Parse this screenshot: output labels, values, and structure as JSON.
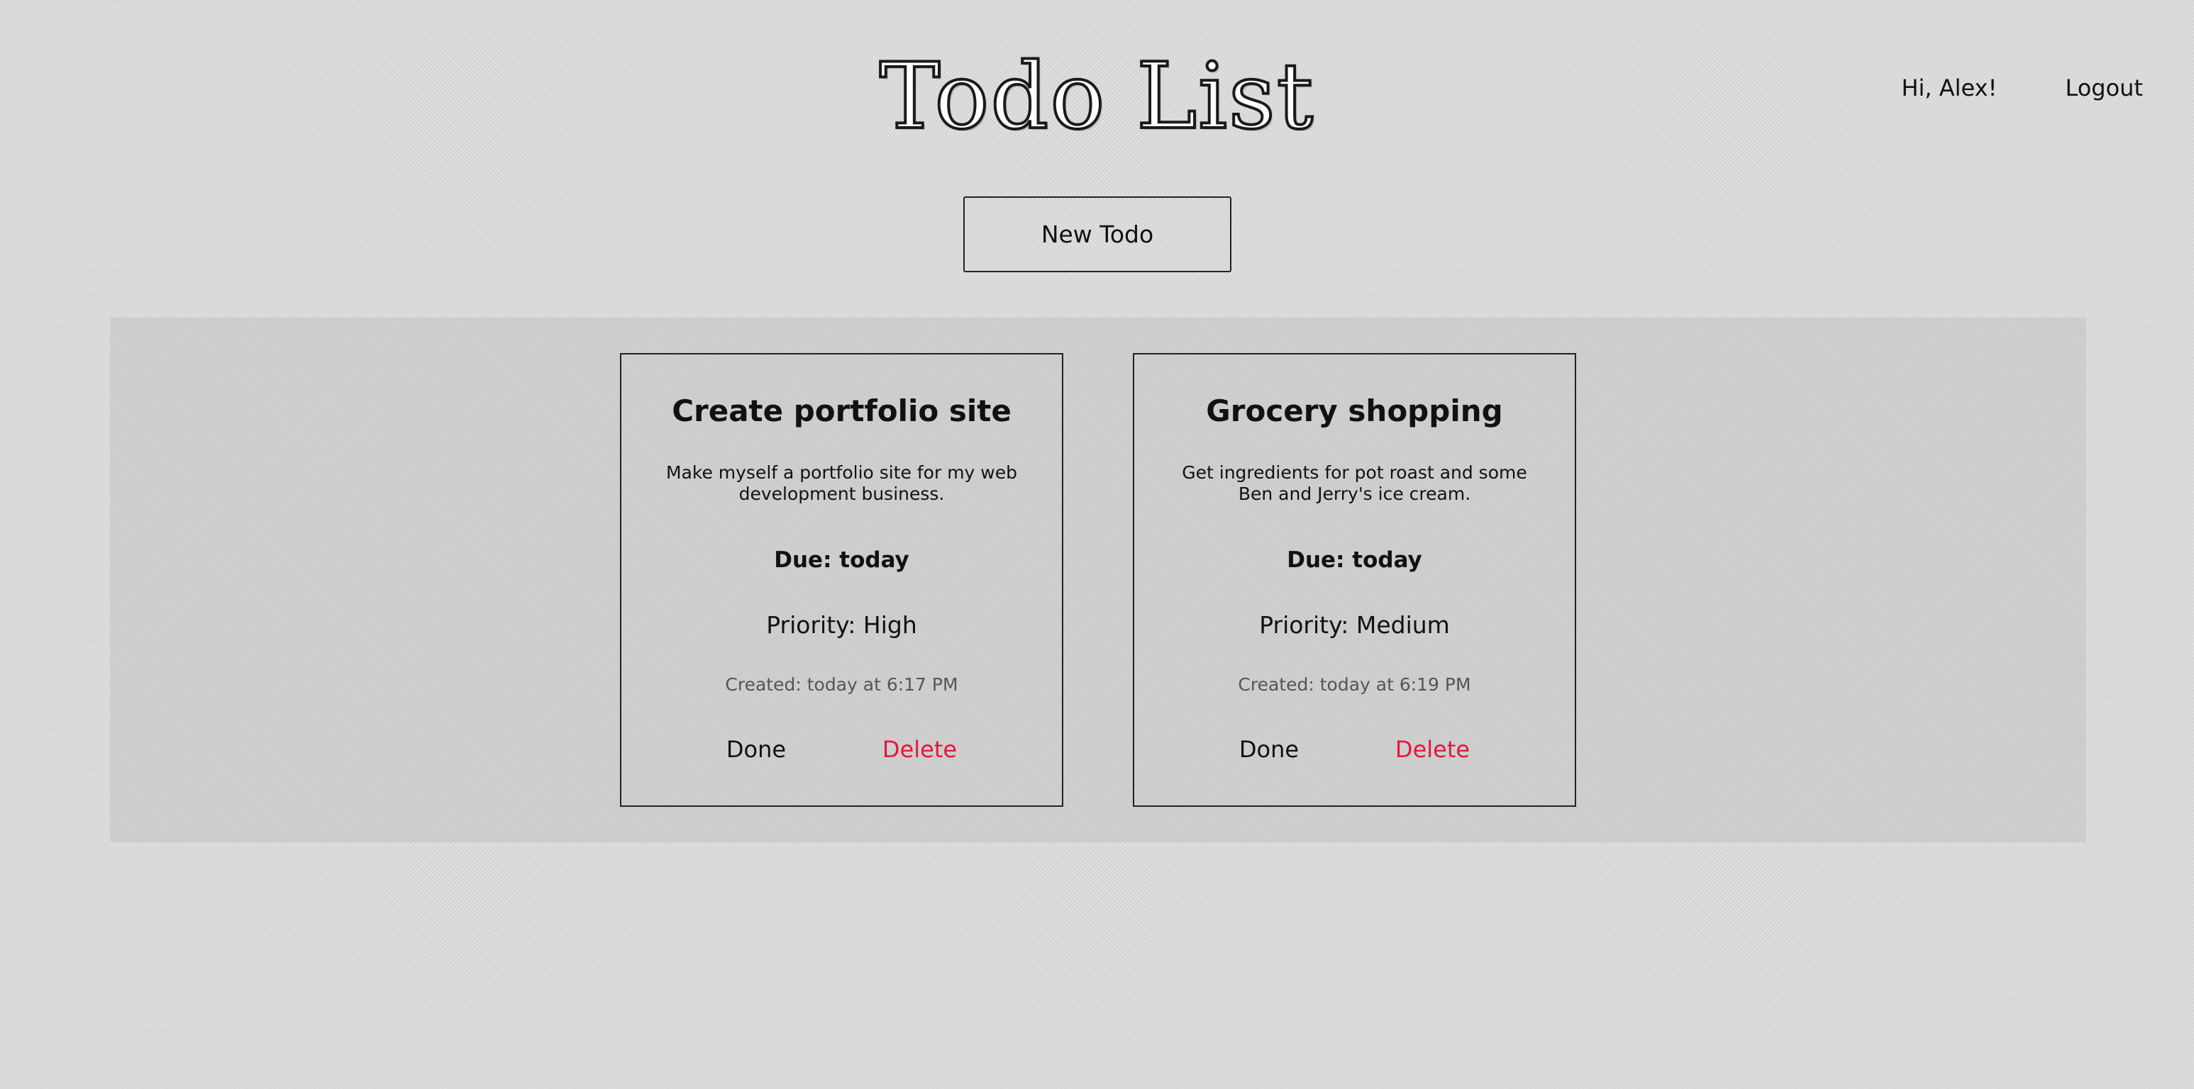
{
  "header": {
    "title": "Todo List",
    "greeting": "Hi, Alex!",
    "logout_label": "Logout"
  },
  "toolbar": {
    "new_todo_label": "New Todo"
  },
  "todos": [
    {
      "title": "Create portfolio site",
      "description": "Make myself a portfolio site for my web development business.",
      "due": "Due: today",
      "priority": "Priority: High",
      "created": "Created: today at 6:17 PM",
      "done_label": "Done",
      "delete_label": "Delete"
    },
    {
      "title": "Grocery shopping",
      "description": "Get ingredients for pot roast and some Ben and Jerry's ice cream.",
      "due": "Due: today",
      "priority": "Priority: Medium",
      "created": "Created: today at 6:19 PM",
      "done_label": "Done",
      "delete_label": "Delete"
    }
  ],
  "colors": {
    "background": "#dedede",
    "delete_accent": "#e8143c",
    "border": "#222222"
  }
}
